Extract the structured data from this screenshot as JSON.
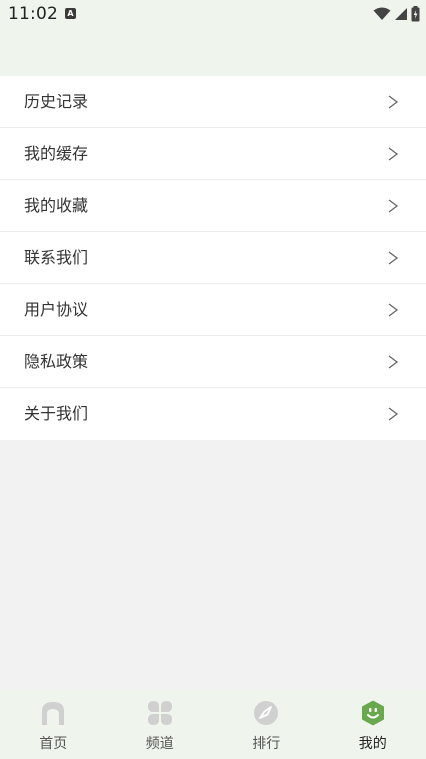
{
  "status_bar": {
    "time": "11:02",
    "notification_icon": "a-icon",
    "wifi_icon": "wifi-icon",
    "signal_icon": "signal-icon",
    "battery_icon": "battery-icon"
  },
  "menu": {
    "items": [
      {
        "label": "历史记录",
        "icon": "chevron-right-icon"
      },
      {
        "label": "我的缓存",
        "icon": "chevron-right-icon"
      },
      {
        "label": "我的收藏",
        "icon": "chevron-right-icon"
      },
      {
        "label": "联系我们",
        "icon": "chevron-right-icon"
      },
      {
        "label": "用户协议",
        "icon": "chevron-right-icon"
      },
      {
        "label": "隐私政策",
        "icon": "chevron-right-icon"
      },
      {
        "label": "关于我们",
        "icon": "chevron-right-icon"
      }
    ]
  },
  "bottom_nav": {
    "items": [
      {
        "label": "首页",
        "icon": "home-icon",
        "active": false
      },
      {
        "label": "频道",
        "icon": "channel-icon",
        "active": false
      },
      {
        "label": "排行",
        "icon": "compass-icon",
        "active": false
      },
      {
        "label": "我的",
        "icon": "smile-face-icon",
        "active": true
      }
    ]
  },
  "colors": {
    "header_bg": "#eff5ec",
    "accent": "#6aa84f",
    "inactive_icon": "#cfcfcf",
    "page_bg": "#f2f2f2"
  }
}
